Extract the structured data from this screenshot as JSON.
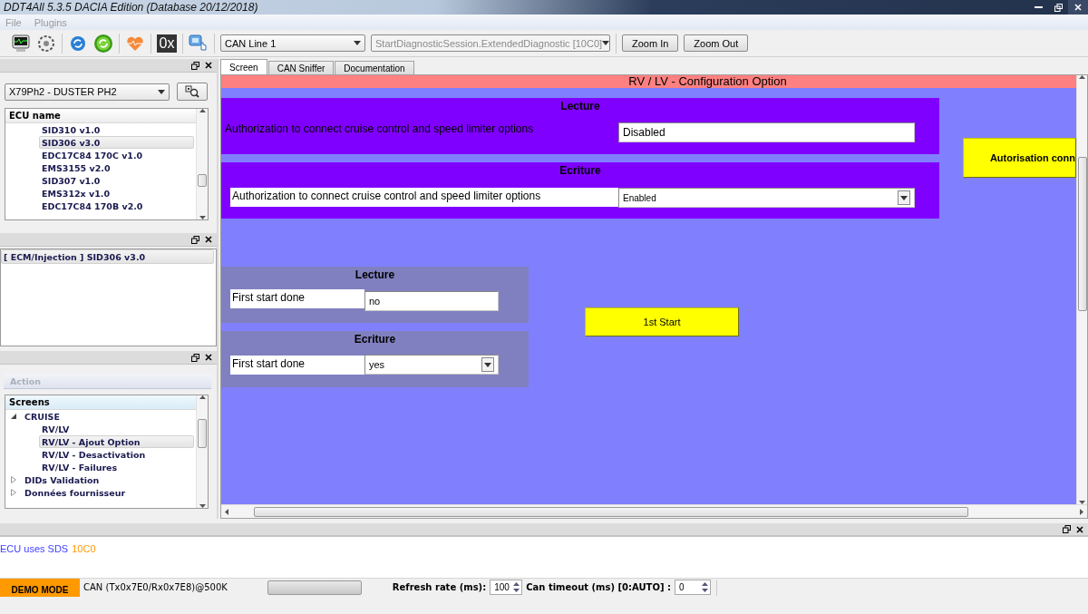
{
  "window": {
    "title": "DDT4All 5.3.5 DACIA Edition (Database 20/12/2018)"
  },
  "menu": [
    {
      "label": "File",
      "disabled": true
    },
    {
      "label": "Plugins",
      "disabled": true
    }
  ],
  "toolbar": {
    "hex_label": "0x",
    "can_line": "CAN Line 1",
    "session": {
      "value": "StartDiagnosticSession.ExtendedDiagnostic [10C0]",
      "disabled": true
    },
    "buttons": [
      "Zoom In",
      "Zoom Out"
    ]
  },
  "vehicle": {
    "value": "X79Ph2 - DUSTER PH2"
  },
  "ecu_list": {
    "header": "ECU name",
    "items": [
      {
        "label": "SID310 v1.0",
        "selected": false
      },
      {
        "label": "SID306 v3.0",
        "selected": true
      },
      {
        "label": "EDC17C84 170C v1.0",
        "selected": false
      },
      {
        "label": "EMS3155 v2.0",
        "selected": false
      },
      {
        "label": "SID307 v1.0",
        "selected": false
      },
      {
        "label": "EMS312x v1.0",
        "selected": false
      },
      {
        "label": "EDC17C84 170B v2.0",
        "selected": false
      }
    ]
  },
  "ecu_panel": {
    "items": [
      {
        "label": "[ ECM/Injection ] SID306 v3.0",
        "selected": true
      }
    ]
  },
  "action_tab": "Action",
  "screens": {
    "header": "Screens",
    "tree": [
      {
        "label": "CRUISE",
        "expanded": true,
        "selected": false,
        "children": [
          {
            "label": "RV/LV",
            "selected": false
          },
          {
            "label": "RV/LV - Ajout Option",
            "selected": true
          },
          {
            "label": "RV/LV - Desactivation",
            "selected": false
          },
          {
            "label": "RV/LV - Failures",
            "selected": false
          }
        ]
      },
      {
        "label": "DIDs Validation",
        "expanded": false,
        "selected": false
      },
      {
        "label": "Données fournisseur",
        "expanded": false,
        "selected": false
      }
    ]
  },
  "tabs": [
    {
      "label": "Screen",
      "selected": true
    },
    {
      "label": "CAN Sniffer",
      "selected": false
    },
    {
      "label": "Documentation",
      "selected": false
    }
  ],
  "screen": {
    "title": "RV / LV - Configuration Option",
    "panels": [
      {
        "kind": "read",
        "title": "Lecture",
        "color": "#8000ff",
        "label": "Authorization to connect cruise control and speed limiter options",
        "value": "Disabled"
      },
      {
        "kind": "write",
        "title": "Ecriture",
        "color": "#8000ff",
        "label": "Authorization to connect cruise control and speed limiter options",
        "value": "Enabled"
      },
      {
        "kind": "read",
        "title": "Lecture",
        "color": "#8080c0",
        "label": "First start done",
        "value": "no"
      },
      {
        "kind": "write",
        "title": "Ecriture",
        "color": "#8080c0",
        "label": "First start done",
        "value": "yes"
      }
    ],
    "buttons": [
      "Autorisation conn",
      "1st Start"
    ]
  },
  "log": [
    {
      "text": "ECU uses SDS",
      "color": "#4040ff"
    },
    {
      "text": "10C0",
      "color": "#ff9900"
    }
  ],
  "progress": {
    "level": 0
  },
  "status": {
    "mode": "DEMO MODE",
    "can": "CAN (Tx0x7E0/Rx0x7E8)@500K",
    "refresh_label": "Refresh rate (ms):",
    "refresh_value": "100",
    "timeout_label": "Can timeout (ms) [0:AUTO] :",
    "timeout_value": "0"
  }
}
